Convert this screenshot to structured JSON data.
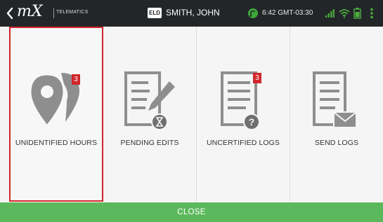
{
  "header": {
    "brand_logo": "mX",
    "brand_sub": "TELEMATICS",
    "eld_badge": "ELD",
    "driver_name": "SMITH, JOHN",
    "clock": "6:42 GMT-03:30"
  },
  "tiles": [
    {
      "label": "UNIDENTIFIED HOURS",
      "icon": "location-pin-icon",
      "badge": "3",
      "selected": true
    },
    {
      "label": "PENDING EDITS",
      "icon": "document-pencil-icon",
      "badge": "",
      "selected": false
    },
    {
      "label": "UNCERTIFIED LOGS",
      "icon": "document-question-icon",
      "badge": "3",
      "selected": false
    },
    {
      "label": "SEND LOGS",
      "icon": "document-envelope-icon",
      "badge": "",
      "selected": false
    }
  ],
  "footer": {
    "close_label": "CLOSE"
  },
  "colors": {
    "topbar": "#232628",
    "accent_green": "#5cb85c",
    "badge_red": "#d1262b",
    "selected_border": "#d1262b",
    "icon_gray": "#8e8e8e"
  }
}
